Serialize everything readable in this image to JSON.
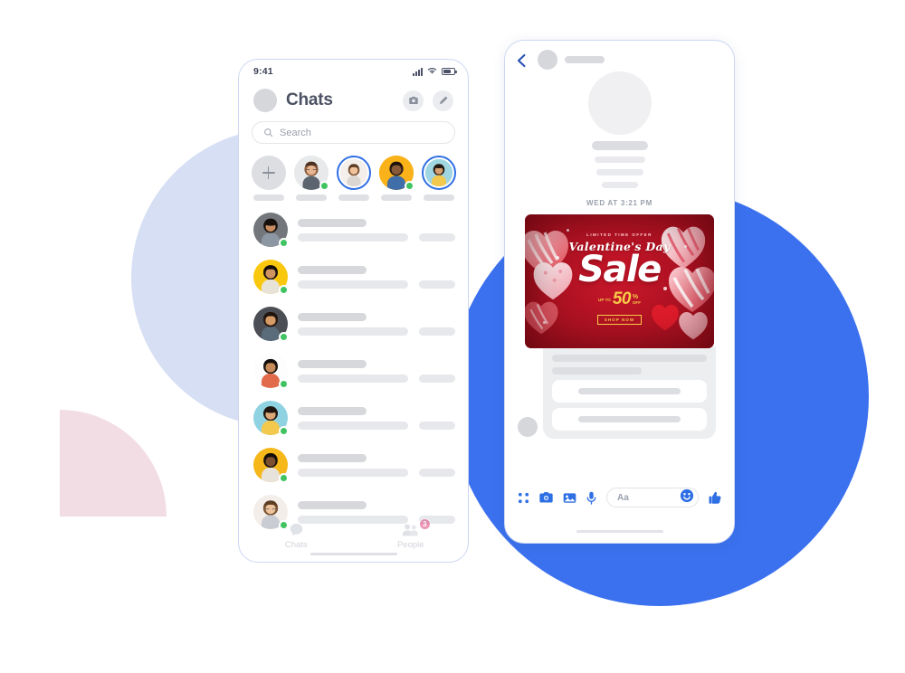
{
  "scene": {
    "background_color": "#ffffff",
    "shapes": {
      "light_blue_circle_color": "#d7dff4",
      "pink_quarter_color": "#f2dde4",
      "blue_circle_color": "#3b71ee"
    }
  },
  "left_phone": {
    "status_bar": {
      "time": "9:41",
      "icons": [
        "signal-icon",
        "wifi-icon",
        "battery-icon"
      ]
    },
    "header": {
      "avatar": "user-avatar",
      "title": "Chats",
      "camera_button": "camera-icon",
      "compose_button": "pencil-icon"
    },
    "search": {
      "icon": "search-icon",
      "placeholder": "Search",
      "value": ""
    },
    "stories": [
      {
        "type": "add",
        "label": "add-story-button",
        "icon": "plus-icon",
        "online": false,
        "ring": false
      },
      {
        "type": "person",
        "label": "story-avatar-1",
        "online": true,
        "ring": false,
        "bg": "#e8e9eb"
      },
      {
        "type": "person",
        "label": "story-avatar-2",
        "online": false,
        "ring": true,
        "bg": "#f3ece8"
      },
      {
        "type": "person",
        "label": "story-avatar-3",
        "online": true,
        "ring": false,
        "bg": "#f9b21a"
      },
      {
        "type": "person",
        "label": "story-avatar-4",
        "online": false,
        "ring": true,
        "bg": "#9fd6e2"
      }
    ],
    "chat_rows": [
      {
        "name": "chat-row-1",
        "online": true,
        "bg": "#6e7276"
      },
      {
        "name": "chat-row-2",
        "online": true,
        "bg": "#f9c80e"
      },
      {
        "name": "chat-row-3",
        "online": true,
        "bg": "#4b4f55"
      },
      {
        "name": "chat-row-4",
        "online": true,
        "bg": "#fdfdfd"
      },
      {
        "name": "chat-row-5",
        "online": true,
        "bg": "#8fd3e3"
      },
      {
        "name": "chat-row-6",
        "online": true,
        "bg": "#f5b719"
      },
      {
        "name": "chat-row-7",
        "online": true,
        "bg": "#f4eeea"
      }
    ],
    "tab_bar": {
      "tabs": [
        {
          "label": "Chats",
          "icon": "chat-bubble-icon",
          "badge": ""
        },
        {
          "label": "People",
          "icon": "people-icon",
          "badge": "3"
        }
      ],
      "badge_color": "#d81b60"
    }
  },
  "right_phone": {
    "header": {
      "back_button": "back-chevron-icon",
      "avatar": "contact-avatar",
      "name_placeholder": "contact-name"
    },
    "profile": {
      "avatar": "large-contact-avatar",
      "placeholder_lines": 4
    },
    "timestamp": "WED AT 3:21 PM",
    "ad": {
      "kicker": "LIMITED TIME OFFER",
      "headline_script": "Valentine's Day",
      "headline_big": "Sale",
      "discount_prefix": "UP TO",
      "discount_value": "50",
      "discount_pct": "%",
      "discount_suffix": "OFF",
      "cta": "SHOP NOW",
      "bg_color": "#b4121c",
      "accent_color": "#f7c948"
    },
    "message_card": {
      "avatar": "sender-avatar",
      "placeholder_lines": 2,
      "buttons": 2
    },
    "composer": {
      "apps_button": "grid-apps-icon",
      "camera_button": "camera-icon",
      "gallery_button": "photo-icon",
      "mic_button": "microphone-icon",
      "input_label": "Aa",
      "input_value": "",
      "emoji_button": "emoji-smiley-icon",
      "like_button": "thumbs-up-icon",
      "accent_color": "#2f6fe4"
    }
  }
}
